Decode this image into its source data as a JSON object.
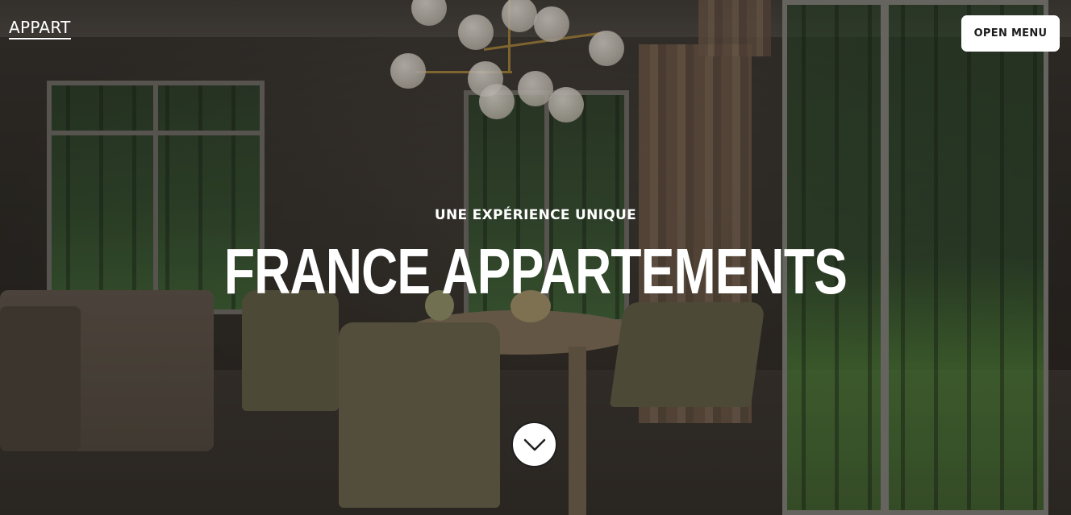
{
  "header": {
    "brand": "APPART",
    "menu_button": "OPEN MENU"
  },
  "hero": {
    "eyebrow": "UNE EXPÉRIENCE UNIQUE",
    "title": "FRANCE APPARTEMENTS",
    "scroll_icon": "chevron-down-icon"
  },
  "colors": {
    "text": "#ffffff",
    "button_bg": "#ffffff",
    "button_text": "#1a1a1a"
  }
}
